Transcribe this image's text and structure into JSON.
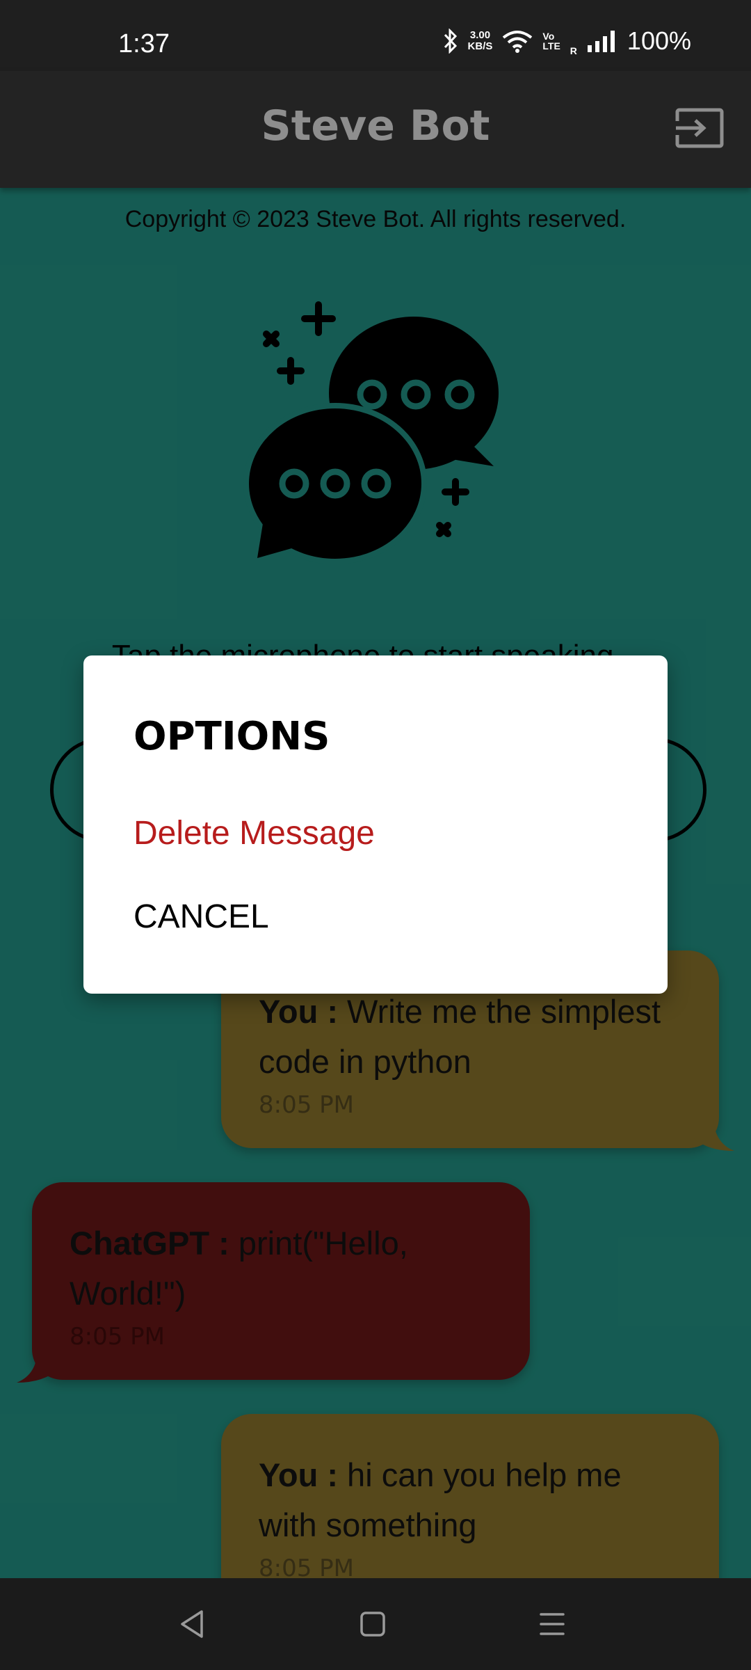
{
  "status_bar": {
    "time": "1:37",
    "net_speed_value": "3.00",
    "net_speed_unit": "KB/S",
    "volte_top": "Vo",
    "volte_bottom": "LTE",
    "roaming": "R",
    "battery": "100%"
  },
  "app_bar": {
    "title": "Steve Bot",
    "logout_icon": "logout-icon"
  },
  "copyright": "Copyright © 2023 Steve Bot. All rights reserved.",
  "hint": "Tap the microphone to start speaking...",
  "messages": [
    {
      "sender": "You :",
      "text": " Write me the simplest code in python",
      "time": "8:05 PM",
      "side": "right"
    },
    {
      "sender": "ChatGPT :",
      "text": " print(\"Hello, World!\")",
      "time": "8:05 PM",
      "side": "left"
    },
    {
      "sender": "You :",
      "text": " hi can you help me with something",
      "time": "8:05 PM",
      "side": "right"
    }
  ],
  "dialog": {
    "title": "OPTIONS",
    "delete_label": "Delete Message",
    "cancel_label": "CANCEL"
  },
  "colors": {
    "background": "#1e7f73",
    "user_bubble": "#786426",
    "bot_bubble": "#5a1414",
    "delete": "#b71c1c"
  },
  "nav_bar": {
    "back_icon": "back-triangle-icon",
    "home_icon": "home-square-icon",
    "recents_icon": "menu-lines-icon"
  }
}
